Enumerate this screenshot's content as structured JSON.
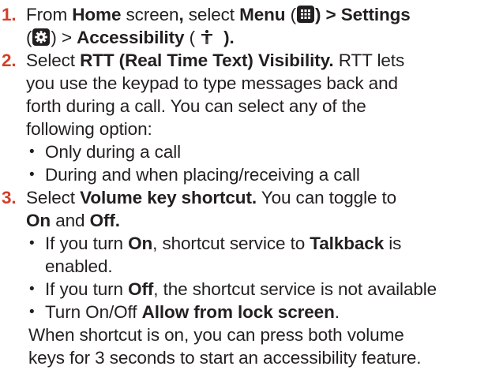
{
  "steps": [
    {
      "number": "1.",
      "lines": [
        [
          "From ",
          "Home",
          " screen",
          ",",
          " select ",
          "Menu",
          " (",
          "",
          ") > Settings"
        ],
        [
          "(",
          "",
          ") > ",
          "Accessibility",
          " (",
          "",
          " )."
        ]
      ]
    },
    {
      "number": "2.",
      "lines": [
        [
          "Select ",
          "RTT (Real Time Text) Visibility.",
          " RTT lets"
        ],
        [
          "you use the keypad to type messages back and"
        ],
        [
          "forth during a call. You can select any of the"
        ],
        [
          "following option:"
        ]
      ],
      "bullets": [
        "Only during a call",
        "During and when placing/receiving a call"
      ]
    },
    {
      "number": "3.",
      "lines": [
        [
          "Select ",
          "Volume key shortcut.",
          " You can toggle to"
        ],
        [
          "On",
          " and ",
          "Off."
        ]
      ],
      "bullets": [
        [
          "If you turn ",
          "On",
          ", shortcut service to ",
          "Talkback",
          " is"
        ],
        [
          "enabled."
        ],
        [
          "If you turn ",
          "Off",
          ", the shortcut service is not available"
        ],
        [
          "Turn On/Off ",
          "Allow from lock screen",
          "."
        ]
      ],
      "tail": [
        "When shortcut is on, you can press both volume",
        "keys for 3 seconds to start an accessibility feature."
      ]
    }
  ],
  "icons": {
    "menu": "grid-menu-icon",
    "settings": "gear-icon",
    "accessibility": "accessibility-person-icon"
  },
  "colors": {
    "step_number": "#d1402a",
    "text": "#231f20"
  }
}
